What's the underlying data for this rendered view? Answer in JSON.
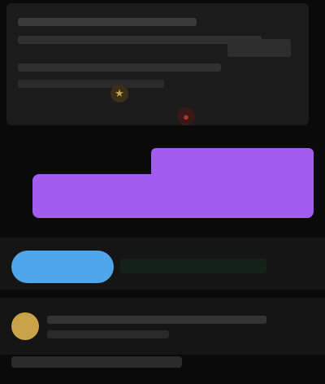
{
  "header": {
    "title": "",
    "subtitle": ""
  },
  "icons": {
    "star": "star-icon",
    "record": "record-icon"
  },
  "bars": {
    "top_bar_label": "",
    "main_bar_label": ""
  },
  "actions": {
    "primary_button_label": ""
  },
  "footer": {
    "caption": ""
  },
  "colors": {
    "background": "#0a0a0a",
    "panel": "#1b1b1b",
    "accent_purple": "#a15cf0",
    "accent_blue": "#4fa6e8",
    "accent_gold": "#c9a24a",
    "accent_red": "#b83232"
  }
}
